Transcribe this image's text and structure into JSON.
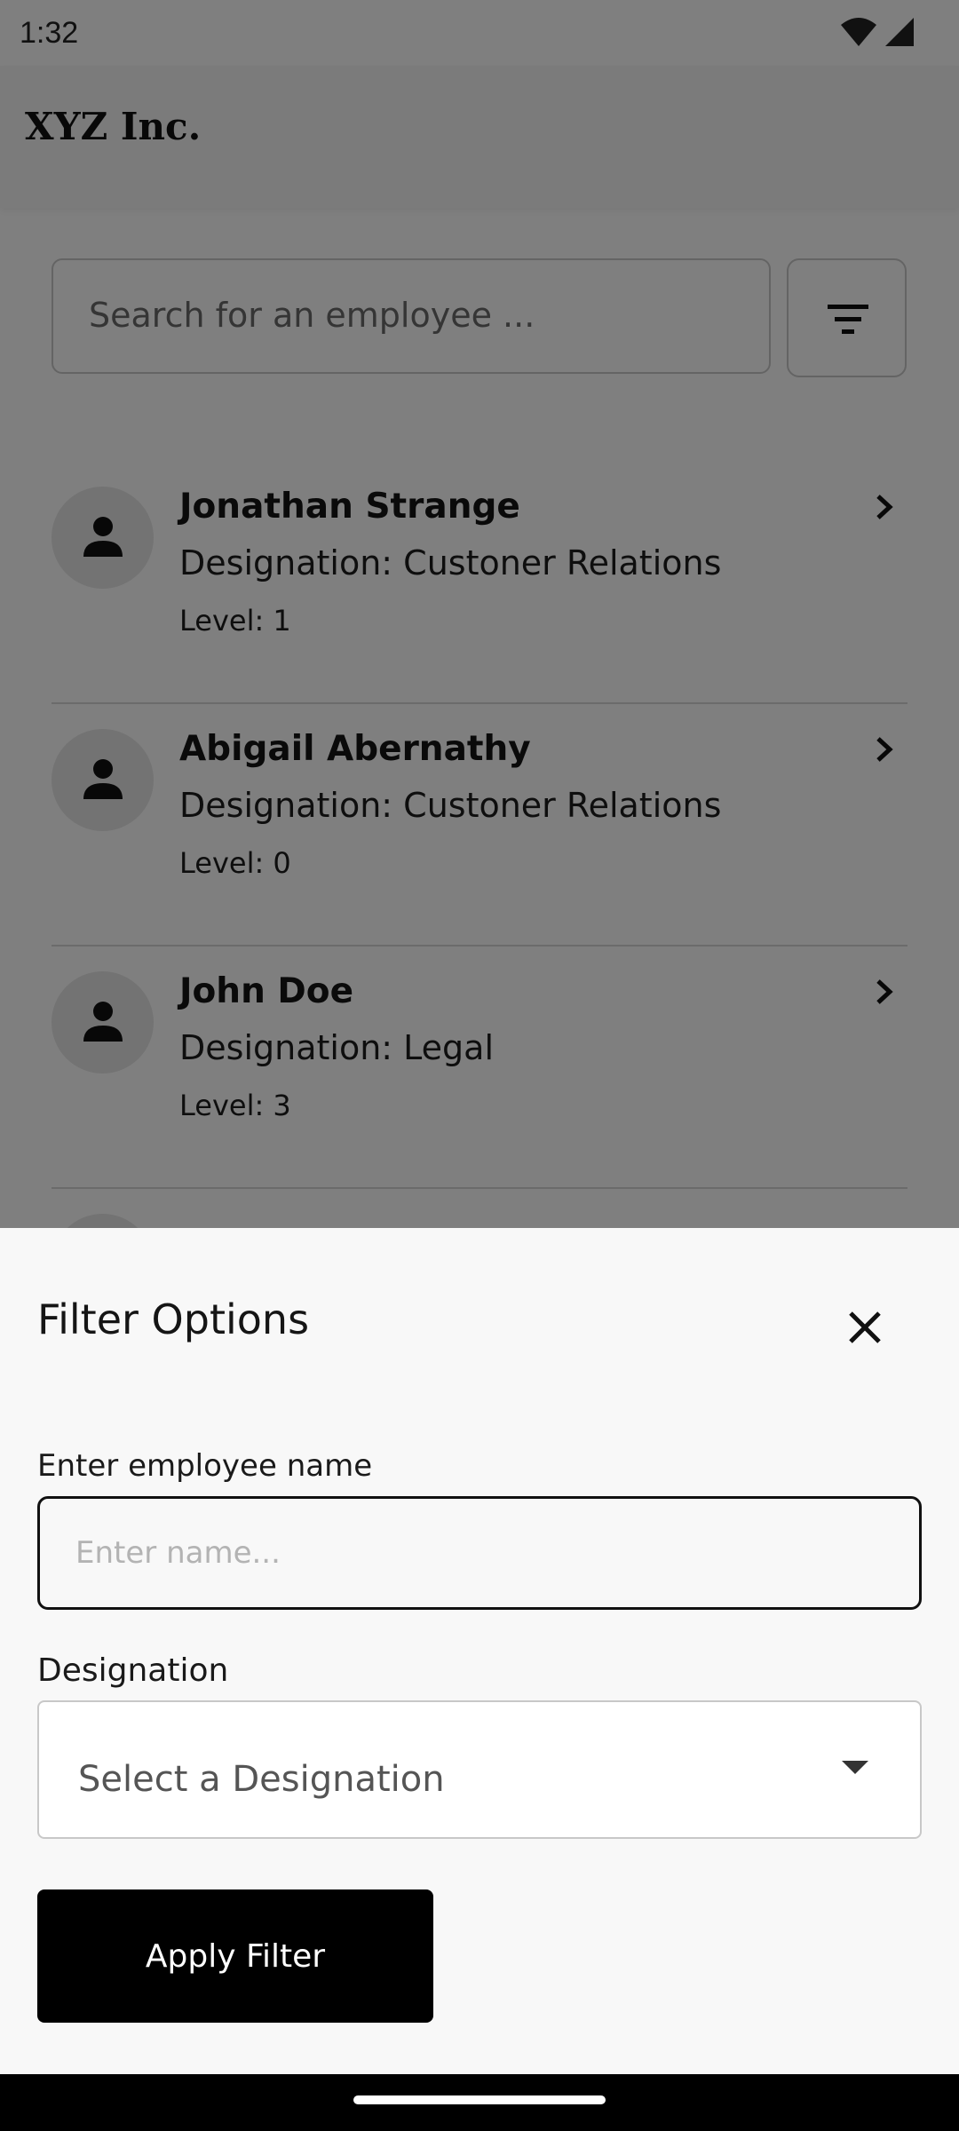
{
  "status_bar": {
    "time": "1:32",
    "icons": [
      "wifi-icon",
      "cellular-signal-icon"
    ]
  },
  "app_bar": {
    "title": "XYZ Inc."
  },
  "search": {
    "placeholder": "Search for an employee ...",
    "filter_icon": "filter-icon"
  },
  "employees": [
    {
      "name": "Jonathan Strange",
      "designation": "Designation: Custoner Relations",
      "level": "Level: 1"
    },
    {
      "name": "Abigail Abernathy",
      "designation": "Designation: Custoner Relations",
      "level": "Level: 0"
    },
    {
      "name": "John Doe",
      "designation": "Designation: Legal",
      "level": "Level: 3"
    }
  ],
  "filter_sheet": {
    "title": "Filter Options",
    "name_label": "Enter employee name",
    "name_placeholder": "Enter name...",
    "name_value": "",
    "designation_label": "Designation",
    "designation_placeholder": "Select a Designation",
    "apply_label": "Apply Filter"
  },
  "colors": {
    "scrim": "#000000",
    "apply_button_bg": "#000000",
    "sheet_bg": "#f8f8f8"
  }
}
